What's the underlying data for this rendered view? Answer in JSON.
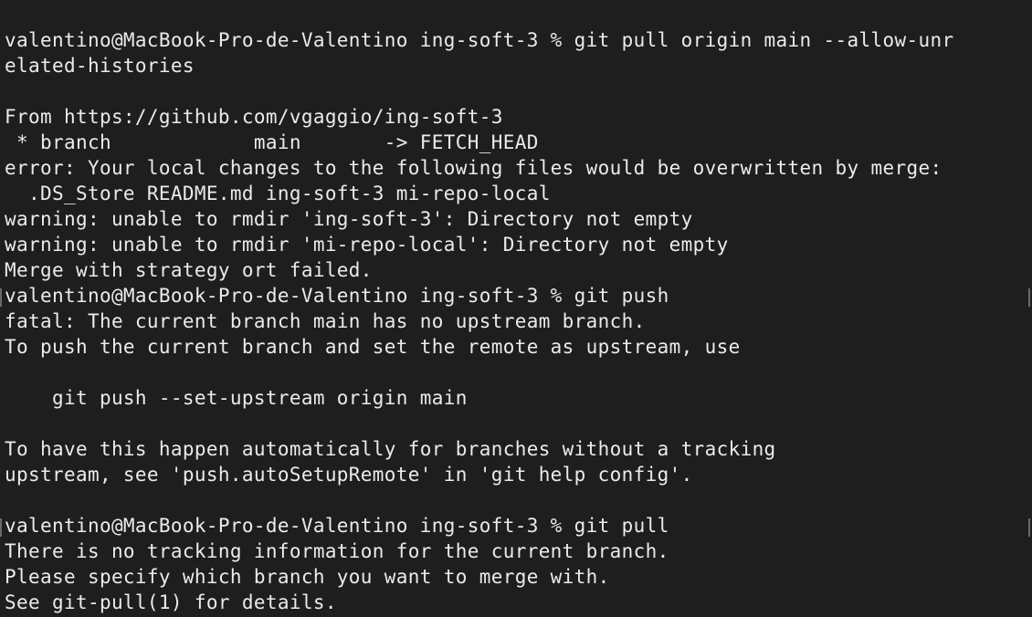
{
  "terminal": {
    "lines": [
      "valentino@MacBook-Pro-de-Valentino ing-soft-3 % git pull origin main --allow-unr",
      "elated-histories",
      "",
      "From https://github.com/vgaggio/ing-soft-3",
      " * branch            main       -> FETCH_HEAD",
      "error: Your local changes to the following files would be overwritten by merge:",
      "  .DS_Store README.md ing-soft-3 mi-repo-local",
      "warning: unable to rmdir 'ing-soft-3': Directory not empty",
      "warning: unable to rmdir 'mi-repo-local': Directory not empty",
      "Merge with strategy ort failed.",
      "valentino@MacBook-Pro-de-Valentino ing-soft-3 % git push",
      "fatal: The current branch main has no upstream branch.",
      "To push the current branch and set the remote as upstream, use",
      "",
      "    git push --set-upstream origin main",
      "",
      "To have this happen automatically for branches without a tracking",
      "upstream, see 'push.autoSetupRemote' in 'git help config'.",
      "",
      "valentino@MacBook-Pro-de-Valentino ing-soft-3 % git pull",
      "There is no tracking information for the current branch.",
      "Please specify which branch you want to merge with.",
      "See git-pull(1) for details."
    ]
  },
  "colors": {
    "background": "#1e1e1e",
    "text": "#ebebeb",
    "prompt_mark": "#6a6a6a"
  }
}
